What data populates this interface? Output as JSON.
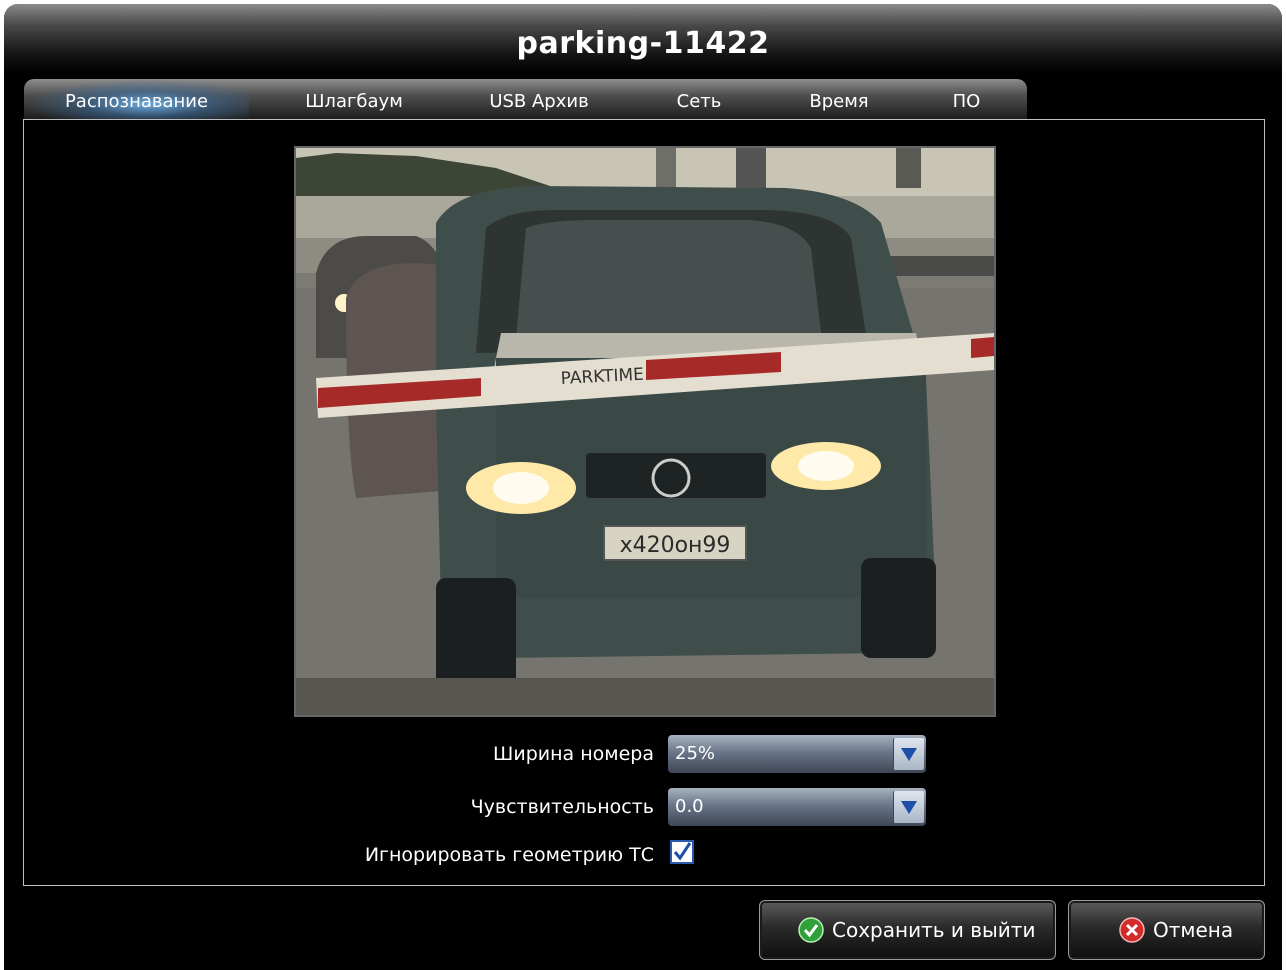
{
  "window": {
    "title": "parking-11422"
  },
  "tabs": [
    {
      "label": "Распознавание",
      "active": true
    },
    {
      "label": "Шлагбаум",
      "active": false
    },
    {
      "label": "USB Архив",
      "active": false
    },
    {
      "label": "Сеть",
      "active": false
    },
    {
      "label": "Время",
      "active": false
    },
    {
      "label": "ПО",
      "active": false
    }
  ],
  "camera": {
    "barrier_text": "PARKTIME",
    "plate_text": "х420он99"
  },
  "settings": {
    "plate_width": {
      "label": "Ширина номера",
      "value": "25%"
    },
    "sensitivity": {
      "label": "Чувствительность",
      "value": "0.0"
    },
    "ignore_geometry": {
      "label": "Игнорировать геометрию ТС",
      "checked": true
    }
  },
  "buttons": {
    "save": "Сохранить и выйти",
    "cancel": "Отмена"
  },
  "colors": {
    "dropdown_arrow": "#1d4fa8",
    "save_icon": "#2fa03a",
    "cancel_icon": "#d42a2a",
    "tab_highlight": "#6eafe6"
  }
}
